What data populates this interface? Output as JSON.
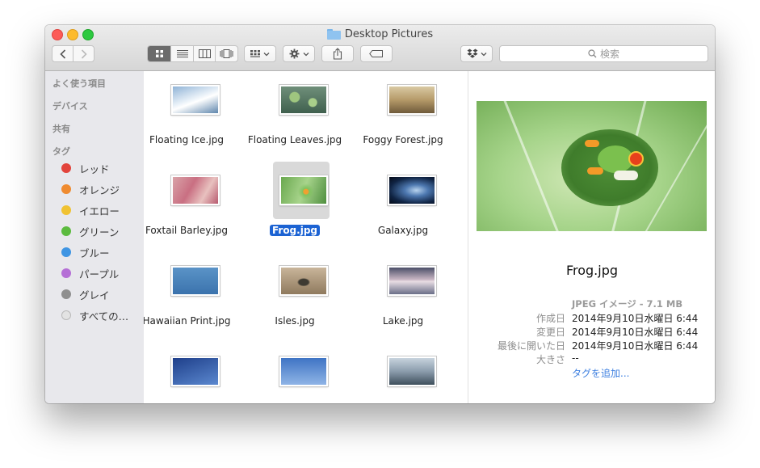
{
  "window": {
    "title": "Desktop Pictures"
  },
  "toolbar": {
    "back_icon": "chevron-left-icon",
    "forward_icon": "chevron-right-icon",
    "view_icons": [
      "grid-view-icon",
      "list-view-icon",
      "column-view-icon",
      "coverflow-view-icon"
    ],
    "search_placeholder": "検索"
  },
  "sidebar": {
    "sections": [
      {
        "label": "よく使う項目"
      },
      {
        "label": "デバイス"
      },
      {
        "label": "共有"
      },
      {
        "label": "タグ"
      }
    ],
    "tags": [
      {
        "label": "レッド",
        "color": "#e2443c"
      },
      {
        "label": "オレンジ",
        "color": "#ef8b30"
      },
      {
        "label": "イエロー",
        "color": "#f0c232"
      },
      {
        "label": "グリーン",
        "color": "#5cbb3f"
      },
      {
        "label": "ブルー",
        "color": "#3f95e3"
      },
      {
        "label": "パープル",
        "color": "#b56fd6"
      },
      {
        "label": "グレイ",
        "color": "#8f8f8f"
      },
      {
        "label": "すべての…",
        "color": "#e3e3e3"
      }
    ]
  },
  "files": [
    {
      "name": "Floating Ice.jpg",
      "selected": false
    },
    {
      "name": "Floating Leaves.jpg",
      "selected": false
    },
    {
      "name": "Foggy Forest.jpg",
      "selected": false
    },
    {
      "name": "Foxtail Barley.jpg",
      "selected": false
    },
    {
      "name": "Frog.jpg",
      "selected": true
    },
    {
      "name": "Galaxy.jpg",
      "selected": false
    },
    {
      "name": "Hawaiian Print.jpg",
      "selected": false
    },
    {
      "name": "Isles.jpg",
      "selected": false
    },
    {
      "name": "Lake.jpg",
      "selected": false
    },
    {
      "name": "",
      "selected": false
    },
    {
      "name": "",
      "selected": false
    },
    {
      "name": "",
      "selected": false
    }
  ],
  "preview": {
    "name": "Frog.jpg",
    "kind": "JPEG イメージ - 7.1 MB",
    "rows": [
      {
        "label": "作成日",
        "value": "2014年9月10日水曜日 6:44"
      },
      {
        "label": "変更日",
        "value": "2014年9月10日水曜日 6:44"
      },
      {
        "label": "最後に開いた日",
        "value": "2014年9月10日水曜日 6:44"
      },
      {
        "label": "大きさ",
        "value": "--"
      }
    ],
    "add_tag": "タグを追加..."
  }
}
